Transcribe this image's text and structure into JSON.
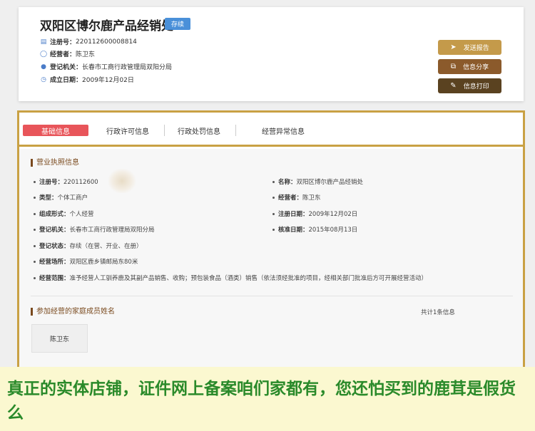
{
  "company": {
    "name": "双阳区博尔鹿产品经销处",
    "status": "存续",
    "reg_no_label": "注册号：",
    "reg_no": "220112600008814",
    "operator_label": "经营者：",
    "operator": "陈卫东",
    "authority_label": "登记机关：",
    "authority": "长春市工商行政管理局双阳分局",
    "founded_label": "成立日期：",
    "founded": "2009年12月02日"
  },
  "actions": {
    "report": "发送报告",
    "share": "信息分享",
    "print": "信息打印"
  },
  "tabs": [
    "基础信息",
    "行政许可信息",
    "行政处罚信息",
    "经营异常信息"
  ],
  "license": {
    "section_title": "营业执照信息",
    "left": [
      {
        "k": "注册号：",
        "v": "220112600"
      },
      {
        "k": "类型：",
        "v": "个体工商户"
      },
      {
        "k": "组成形式：",
        "v": "个人经营"
      },
      {
        "k": "登记机关：",
        "v": "长春市工商行政管理局双阳分局"
      },
      {
        "k": "登记状态：",
        "v": "存续（在营、开业、在册）"
      },
      {
        "k": "经营场所：",
        "v": "双阳区鹿乡镇邮局东80米"
      },
      {
        "k": "经营范围：",
        "v": "准予经营人工驯养鹿及其副产品销售、收购；预包装食品（酒类）销售（依法须经批准的项目，经相关部门批准后方可开展经营活动）"
      }
    ],
    "right": [
      {
        "k": "名称：",
        "v": "双阳区博尔鹿产品经销处"
      },
      {
        "k": "经营者：",
        "v": "陈卫东"
      },
      {
        "k": "注册日期：",
        "v": "2009年12月02日"
      },
      {
        "k": "核准日期：",
        "v": "2015年08月13日"
      }
    ]
  },
  "family": {
    "section_title": "参加经营的家庭成员姓名",
    "count": "共计1条信息",
    "member": "陈卫东"
  },
  "caption": "真正的实体店铺，证件网上备案咱们家都有，您还怕买到的鹿茸是假货么",
  "colors": {
    "accent_gold": "#c9a144",
    "active_tab": "#e8555a",
    "badge_blue": "#4a90d9",
    "caption_green": "#2a8a2a"
  },
  "icons": [
    "book-icon",
    "user-icon",
    "location-pin-icon",
    "clock-icon",
    "paper-plane-icon",
    "share-icon",
    "pencil-icon"
  ]
}
